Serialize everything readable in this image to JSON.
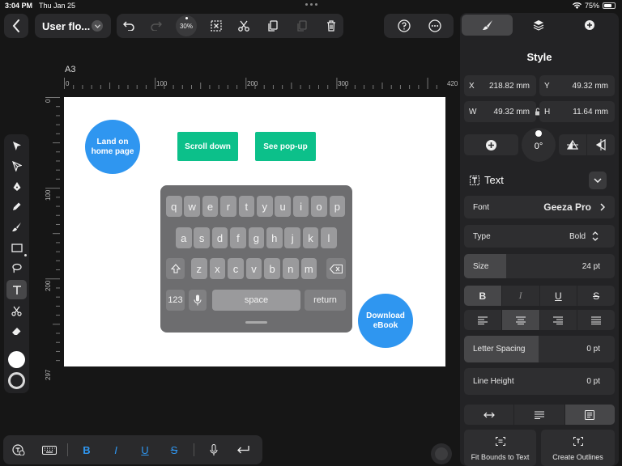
{
  "status": {
    "time": "3:04 PM",
    "date": "Thu Jan 25",
    "battery": "75%"
  },
  "toolbar": {
    "doc_title": "User flo...",
    "zoom": "30%"
  },
  "canvas": {
    "page_label": "A3",
    "ruler_top": [
      "0",
      "100",
      "200",
      "300",
      "420"
    ],
    "ruler_left": [
      "0",
      "100",
      "200",
      "297"
    ],
    "nodes": {
      "land": "Land on home page",
      "scroll": "Scroll down",
      "popup": "See pop-up",
      "download": "Download eBook"
    }
  },
  "keyboard": {
    "row1": [
      "q",
      "w",
      "e",
      "r",
      "t",
      "y",
      "u",
      "i",
      "o",
      "p"
    ],
    "row2": [
      "a",
      "s",
      "d",
      "f",
      "g",
      "h",
      "j",
      "k",
      "l"
    ],
    "row3": [
      "z",
      "x",
      "c",
      "v",
      "b",
      "n",
      "m"
    ],
    "numbers": "123",
    "space": "space",
    "return": "return"
  },
  "bottom_bar": {
    "bold": "B",
    "italic": "I",
    "underline": "U",
    "strike": "S",
    "accent": "#2f96f0"
  },
  "panel": {
    "title": "Style",
    "x_label": "X",
    "x_value": "218.82 mm",
    "y_label": "Y",
    "y_value": "49.32 mm",
    "w_label": "W",
    "w_value": "49.32 mm",
    "h_label": "H",
    "h_value": "11.64 mm",
    "rotation": "0°",
    "section": "Text",
    "font_label": "Font",
    "font_value": "Geeza Pro",
    "type_label": "Type",
    "type_value": "Bold",
    "size_label": "Size",
    "size_value": "24 pt",
    "style_b": "B",
    "style_i": "I",
    "style_u": "U",
    "style_s": "S",
    "letter_label": "Letter Spacing",
    "letter_value": "0 pt",
    "line_label": "Line Height",
    "line_value": "0 pt",
    "fit_label": "Fit Bounds to Text",
    "outline_label": "Create Outlines"
  },
  "colors": {
    "node_blue": "#2f96f0",
    "node_green": "#0cc08a",
    "panel_bg": "#232325"
  }
}
